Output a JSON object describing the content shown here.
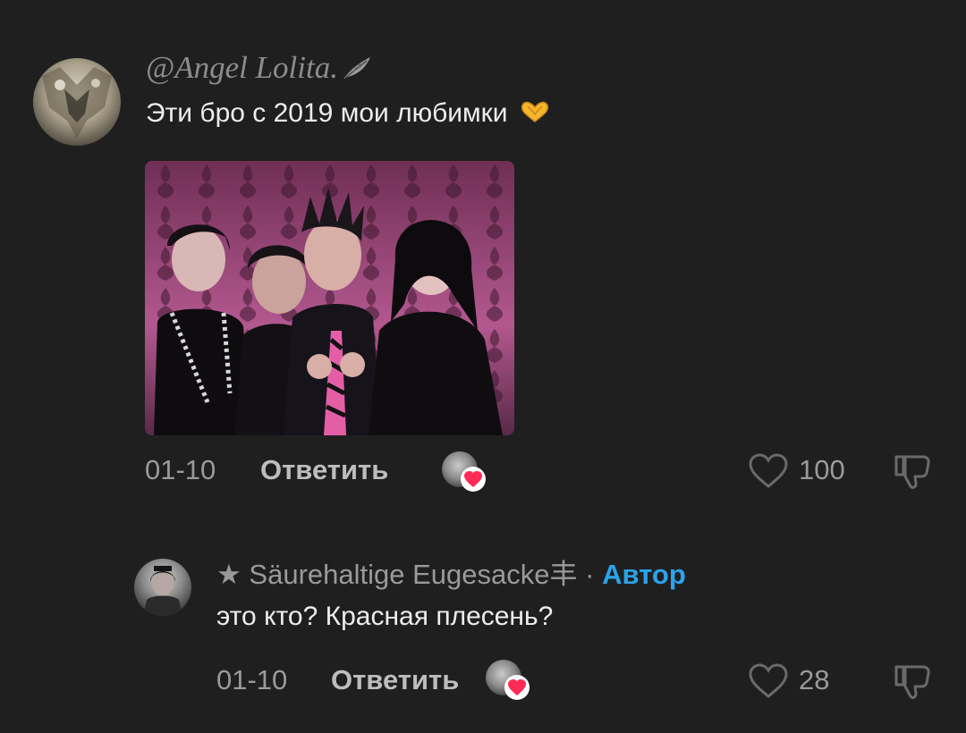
{
  "comments": [
    {
      "username": "@Angel Lolita.",
      "text": "Эти бро с 2019 мои любимки",
      "date": "01-10",
      "reply_label": "Ответить",
      "likes": "100",
      "icons": [
        "feather-icon",
        "heart-hands-icon",
        "heart-outline-icon",
        "thumbs-down-icon",
        "creator-liked-heart-icon"
      ]
    },
    {
      "star": "★",
      "username": "Säurehaltige Eugesacke丰",
      "separator": "·",
      "author_tag": "Автор",
      "text": "это кто? Красная плесень?",
      "date": "01-10",
      "reply_label": "Ответить",
      "likes": "28"
    }
  ],
  "colors": {
    "background": "#1f1f1f",
    "author_accent": "#2aa3ea",
    "like_badge": "#ff2b54"
  }
}
